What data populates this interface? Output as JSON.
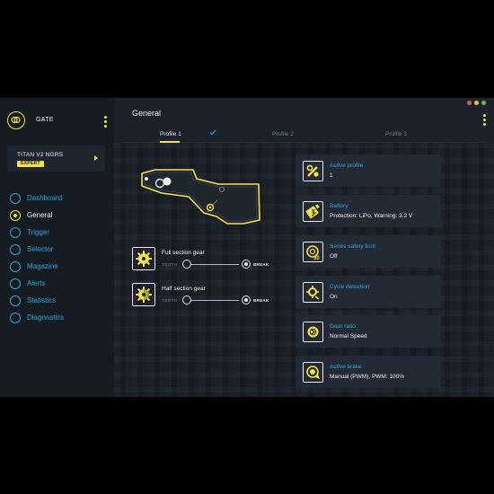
{
  "brand": {
    "name": "GATE",
    "logo_icon": "gate-logo-icon"
  },
  "device": {
    "name": "TITAN V2 NGRS",
    "badge": "EXPERT"
  },
  "nav": {
    "items": [
      {
        "label": "Dashboard",
        "active": false
      },
      {
        "label": "General",
        "active": true
      },
      {
        "label": "Trigger",
        "active": false
      },
      {
        "label": "Selector",
        "active": false
      },
      {
        "label": "Magazine",
        "active": false
      },
      {
        "label": "Alerts",
        "active": false
      },
      {
        "label": "Statistics",
        "active": false
      },
      {
        "label": "Diagnostics",
        "active": false
      }
    ]
  },
  "page": {
    "title": "General"
  },
  "tabs": [
    {
      "label": "Profile 1",
      "active": true,
      "icon": "check-icon"
    },
    {
      "label": "Profile 2",
      "active": false
    },
    {
      "label": "Profile 3",
      "active": false
    }
  ],
  "gears": [
    {
      "label": "Full section gear",
      "left": "TOOTH",
      "right": "BREAK",
      "selected": "BREAK",
      "icon": "full-gear-icon"
    },
    {
      "label": "Half section gear",
      "left": "TOOTH",
      "right": "BREAK",
      "selected": "BREAK",
      "icon": "half-gear-icon"
    }
  ],
  "cards": [
    {
      "title": "Active profile",
      "value": "1",
      "icon": "active-profile-icon"
    },
    {
      "title": "Battery",
      "value": "Protection: LiPo, Warning: 3.2 V",
      "icon": "battery-icon"
    },
    {
      "title": "Series safety limit",
      "value": "Off",
      "icon": "series-safety-limit-icon",
      "icon_text": "30"
    },
    {
      "title": "Cycle detection",
      "value": "On",
      "icon": "cycle-detection-icon"
    },
    {
      "title": "Gear ratio",
      "value": "Normal Speed",
      "icon": "gear-ratio-icon"
    },
    {
      "title": "Active brake",
      "value": "Manual (PWM), PWM: 100%",
      "icon": "active-brake-icon"
    }
  ],
  "colors": {
    "accent": "#f2e24a",
    "link": "#2ea6d9",
    "bg": "#1a1f28",
    "card": "#242a33",
    "window_dots": [
      "#e05b4c",
      "#e8b93a",
      "#5cbf4a"
    ]
  }
}
